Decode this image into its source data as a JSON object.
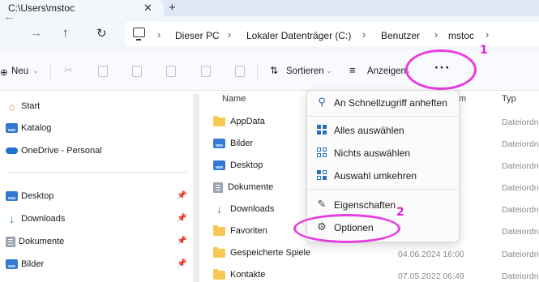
{
  "tab": {
    "title": "C:\\Users\\mstoc",
    "close_icon": "close-icon",
    "new_tab_icon": "plus-icon"
  },
  "nav": {
    "back_icon": "arrow-left-icon",
    "forward_icon": "arrow-right-icon",
    "up_icon": "arrow-up-icon",
    "refresh_icon": "refresh-icon"
  },
  "breadcrumb": [
    "Dieser PC",
    "Lokaler Datenträger (C:)",
    "Benutzer",
    "mstoc"
  ],
  "command_bar": {
    "new_label": "Neu",
    "sort_label": "Sortieren",
    "view_label": "Anzeigen",
    "more_label": "···"
  },
  "sidebar": {
    "items_top": [
      "Start",
      "Katalog",
      "OneDrive - Personal"
    ],
    "items_pinned": [
      "Desktop",
      "Downloads",
      "Dokumente",
      "Bilder"
    ]
  },
  "columns": {
    "name": "Name",
    "type": "Typ",
    "date_partial": "m"
  },
  "files": [
    {
      "name": "AppData",
      "date": "",
      "type": "Dateiordne"
    },
    {
      "name": "Bilder",
      "date": "",
      "type": "Dateiordne"
    },
    {
      "name": "Desktop",
      "date": "",
      "type": "Dateiordne"
    },
    {
      "name": "Dokumente",
      "date": "",
      "type": "Dateiordne"
    },
    {
      "name": "Downloads",
      "date": "",
      "type": "Dateiordne"
    },
    {
      "name": "Favoriten",
      "date": "",
      "type": "Dateiordne"
    },
    {
      "name": "Gespeicherte Spiele",
      "date": "04.06.2024 16:00",
      "type": "Dateiordne"
    },
    {
      "name": "Kontakte",
      "date": "07.05.2022 06:49",
      "type": "Dateiordne"
    }
  ],
  "context_menu": {
    "items": [
      {
        "label": "An Schnellzugriff anheften",
        "icon": "pin-icon"
      },
      {
        "label": "Alles auswählen",
        "icon": "select-all-icon"
      },
      {
        "label": "Nichts auswählen",
        "icon": "select-none-icon"
      },
      {
        "label": "Auswahl umkehren",
        "icon": "invert-selection-icon"
      },
      {
        "label": "Eigenschaften",
        "icon": "properties-icon"
      },
      {
        "label": "Optionen",
        "icon": "options-gear-icon"
      }
    ]
  },
  "annotations": {
    "marker_1": "1",
    "marker_2": "2",
    "color": "#e83ee0"
  },
  "colors": {
    "accent": "#2a6fb8",
    "folder": "#f7c853",
    "tabbar": "#dfe9f5"
  }
}
